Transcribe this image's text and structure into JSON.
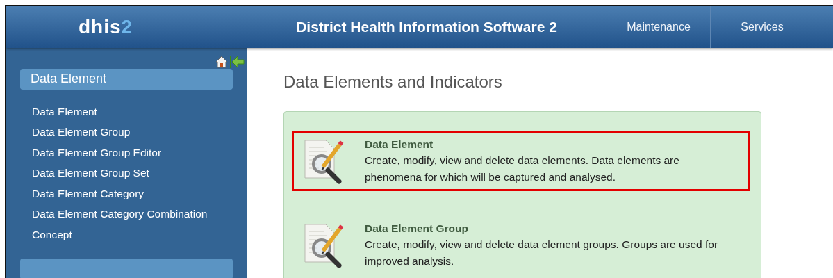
{
  "header": {
    "logo": {
      "text": "dhis",
      "accent": "2"
    },
    "title": "District Health Information Software 2",
    "nav": [
      {
        "label": "Maintenance"
      },
      {
        "label": "Services"
      }
    ]
  },
  "sidebar": {
    "section": {
      "title": "Data Element",
      "items": [
        "Data Element",
        "Data Element Group",
        "Data Element Group Editor",
        "Data Element Group Set",
        "Data Element Category",
        "Data Element Category Combination",
        "Concept"
      ]
    }
  },
  "main": {
    "title": "Data Elements and Indicators",
    "items": [
      {
        "title": "Data Element",
        "description": "Create, modify, view and delete data elements. Data elements are phenomena for which will be captured and analysed.",
        "highlighted": true
      },
      {
        "title": "Data Element Group",
        "description": "Create, modify, view and delete data element groups. Groups are used for improved analysis.",
        "highlighted": false
      }
    ]
  }
}
